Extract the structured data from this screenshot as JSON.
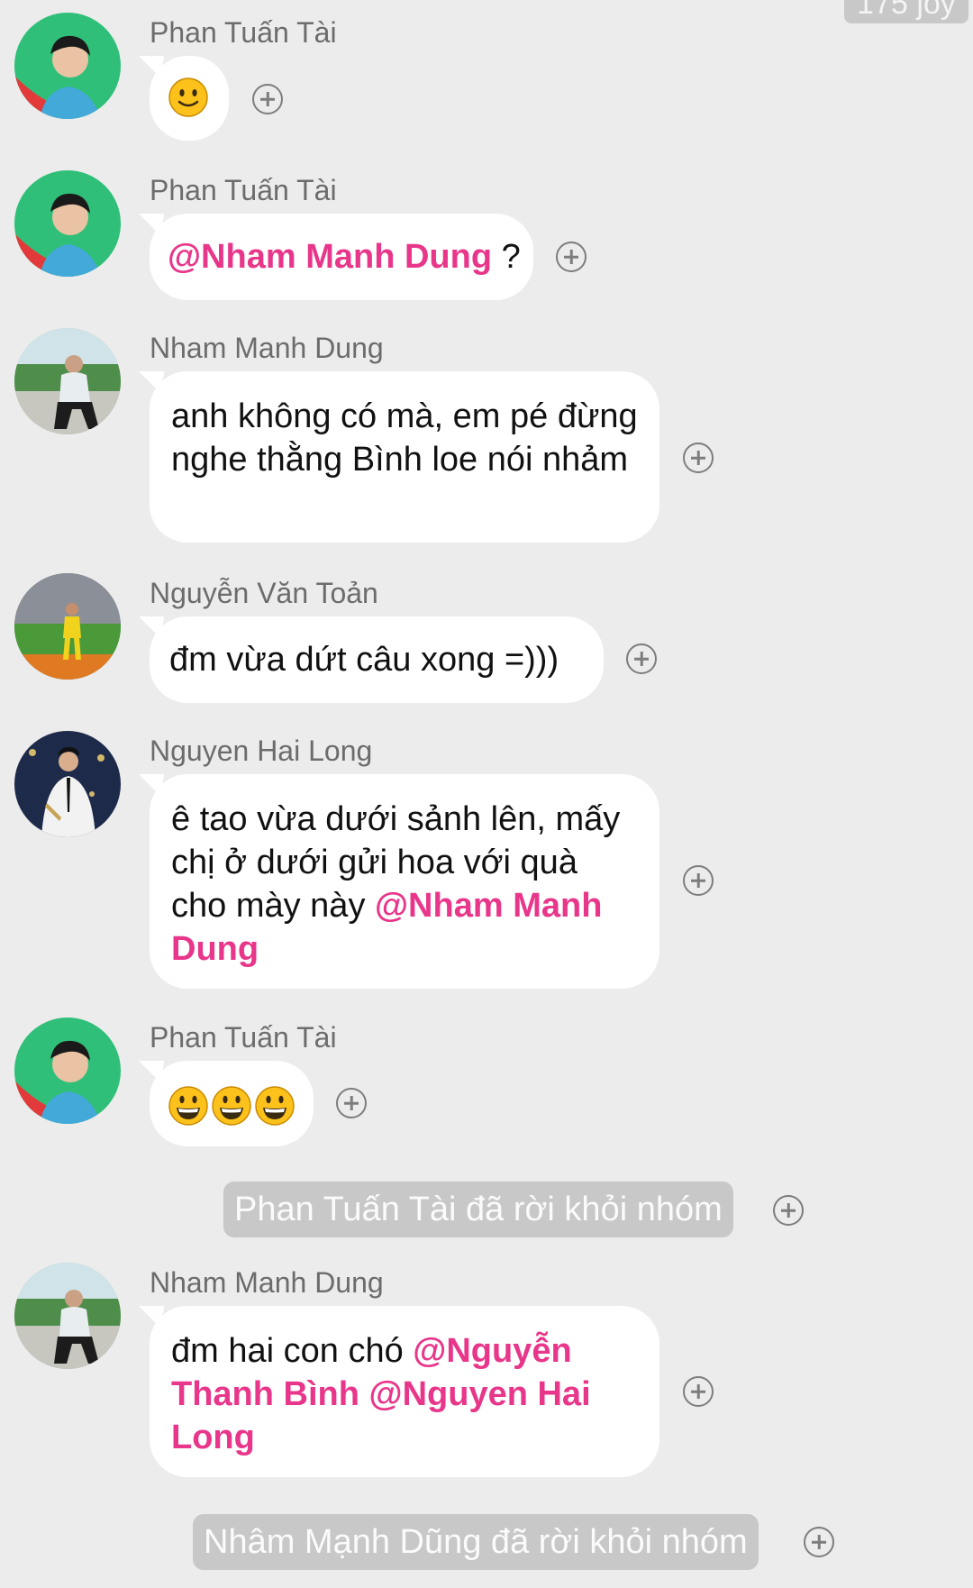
{
  "top_badge": "175 joy",
  "colors": {
    "background": "#ececec",
    "bubble": "#ffffff",
    "mention": "#e8368a",
    "sender_name": "#6c6c6c",
    "system_pill": "#c8c8c8"
  },
  "messages": [
    {
      "sender": "Phan Tuấn Tài",
      "avatar": "avatar-phan-tuan-tai",
      "content": "slightly-smiling-emoji"
    },
    {
      "sender": "Phan Tuấn Tài",
      "avatar": "avatar-phan-tuan-tai",
      "mention": "@Nham Manh Dung",
      "text_after": " ?"
    },
    {
      "sender": "Nham Manh Dung",
      "avatar": "avatar-nham-manh-dung",
      "text": "anh không có mà, em pé đừng nghe thằng Bình loe nói nhảm"
    },
    {
      "sender": "Nguyễn Văn Toản",
      "avatar": "avatar-nguyen-van-toan",
      "text": "đm vừa dứt câu xong =)))"
    },
    {
      "sender": "Nguyen Hai Long",
      "avatar": "avatar-nguyen-hai-long",
      "text_before": "ê tao vừa dưới sảnh lên, mấy chị ở dưới gửi hoa với quà cho mày này ",
      "mention": "@Nham Manh Dung"
    },
    {
      "sender": "Phan Tuấn Tài",
      "avatar": "avatar-phan-tuan-tai",
      "content": "three-grinning-emojis"
    },
    {
      "sender": "Nham Manh Dung",
      "avatar": "avatar-nham-manh-dung",
      "text_before": "đm hai con chó ",
      "mention_1": "@Nguyễn Thanh Bình",
      "mention_2": "@Nguyen Hai Long"
    }
  ],
  "system_messages": [
    "Phan Tuấn Tài đã rời khỏi nhóm",
    "Nhâm Mạnh Dũng đã rời khỏi nhóm"
  ],
  "icons": {
    "reaction": "add-reaction-icon"
  }
}
